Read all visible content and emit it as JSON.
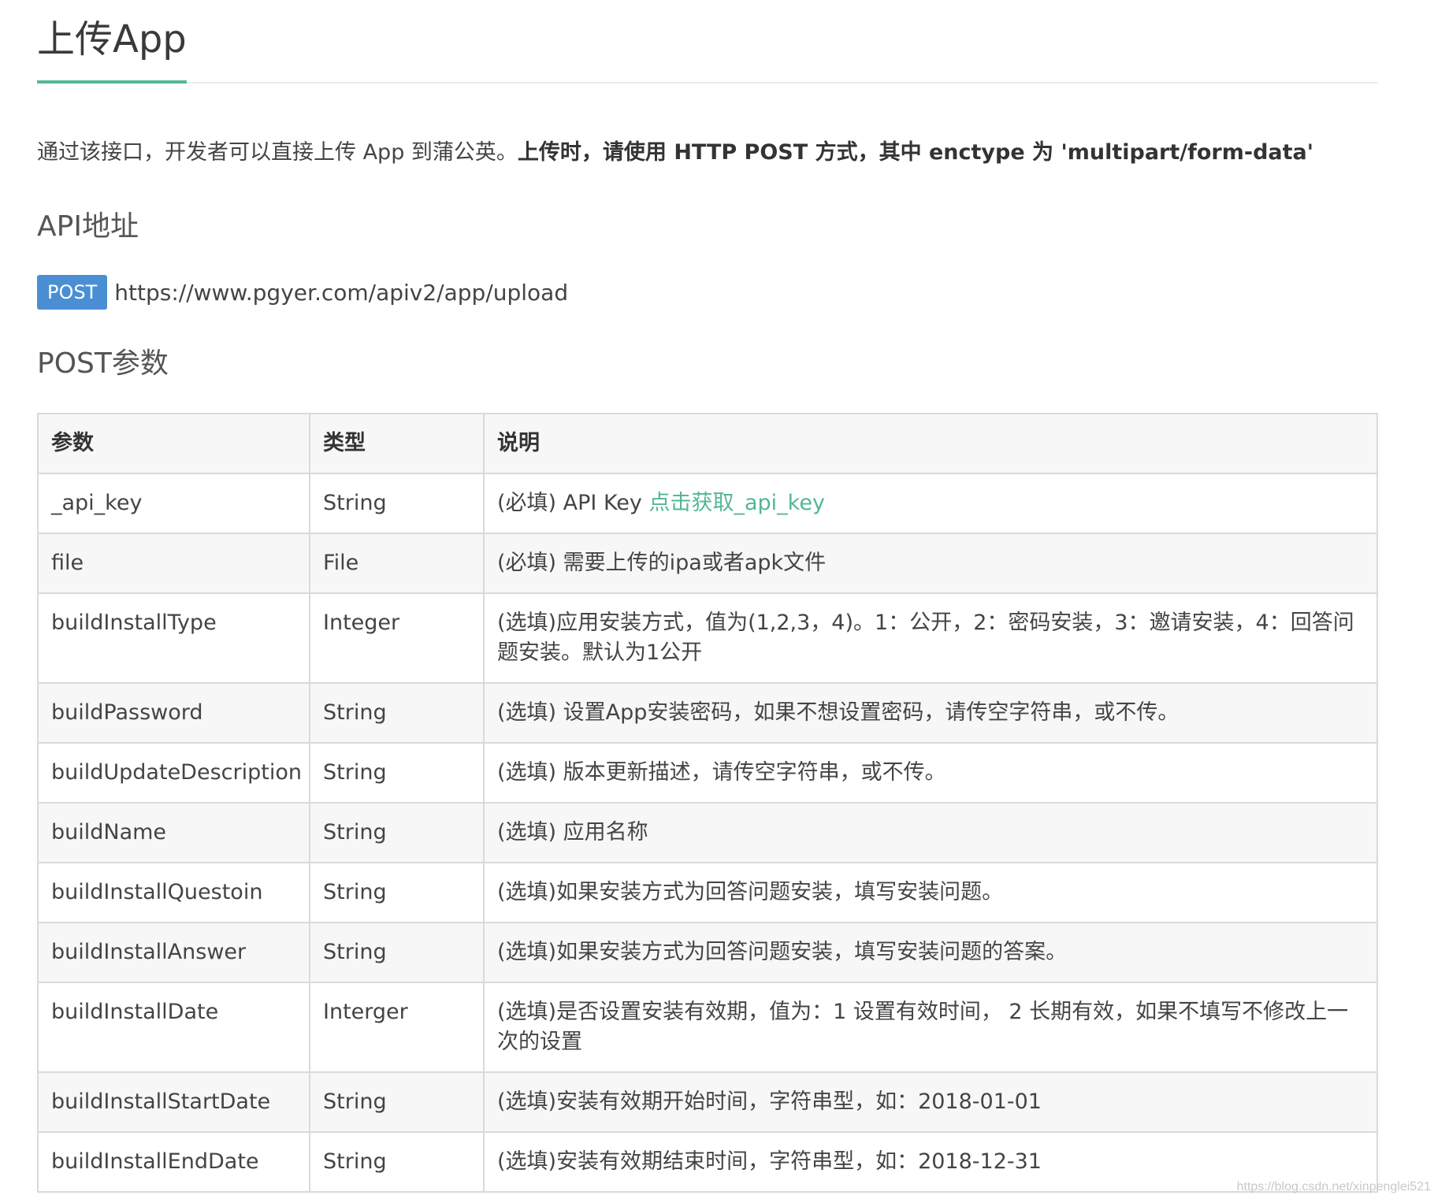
{
  "page": {
    "title": "上传App",
    "intro_plain": "通过该接口，开发者可以直接上传 App 到蒲公英。",
    "intro_bold": "上传时，请使用 HTTP POST 方式，其中 enctype 为 'multipart/form-data'",
    "api_address_heading": "API地址",
    "endpoint": {
      "method": "POST",
      "url": "https://www.pgyer.com/apiv2/app/upload"
    },
    "post_params_heading": "POST参数"
  },
  "table": {
    "headers": [
      "参数",
      "类型",
      "说明"
    ],
    "rows": [
      {
        "param": "_api_key",
        "type": "String",
        "desc": "(必填) API Key ",
        "link": "点击获取_api_key"
      },
      {
        "param": "file",
        "type": "File",
        "desc": "(必填) 需要上传的ipa或者apk文件"
      },
      {
        "param": "buildInstallType",
        "type": "Integer",
        "desc": "(选填)应用安装方式，值为(1,2,3，4)。1：公开，2：密码安装，3：邀请安装，4：回答问题安装。默认为1公开"
      },
      {
        "param": "buildPassword",
        "type": "String",
        "desc": "(选填) 设置App安装密码，如果不想设置密码，请传空字符串，或不传。"
      },
      {
        "param": "buildUpdateDescription",
        "type": "String",
        "desc": "(选填) 版本更新描述，请传空字符串，或不传。"
      },
      {
        "param": "buildName",
        "type": "String",
        "desc": "(选填) 应用名称"
      },
      {
        "param": "buildInstallQuestoin",
        "type": "String",
        "desc": "(选填)如果安装方式为回答问题安装，填写安装问题。"
      },
      {
        "param": "buildInstallAnswer",
        "type": "String",
        "desc": "(选填)如果安装方式为回答问题安装，填写安装问题的答案。"
      },
      {
        "param": "buildInstallDate",
        "type": "Interger",
        "desc": "(选填)是否设置安装有效期，值为：1 设置有效时间， 2 长期有效，如果不填写不修改上一次的设置"
      },
      {
        "param": "buildInstallStartDate",
        "type": "String",
        "desc": "(选填)安装有效期开始时间，字符串型，如：2018-01-01"
      },
      {
        "param": "buildInstallEndDate",
        "type": "String",
        "desc": "(选填)安装有效期结束时间，字符串型，如：2018-12-31"
      }
    ]
  },
  "watermark": "https://blog.csdn.net/xinpenglei521",
  "colors": {
    "accent": "#52b796",
    "badge": "#4a8fd4"
  }
}
